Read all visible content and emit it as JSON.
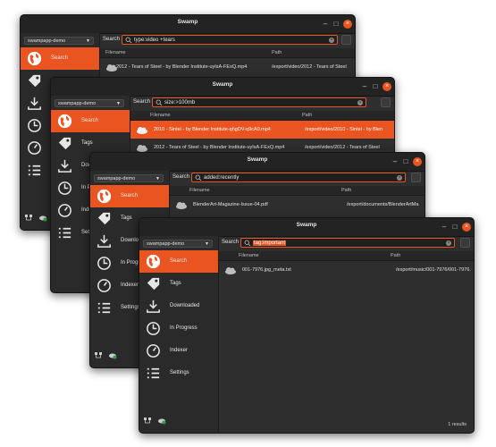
{
  "app": {
    "title": "Swamp"
  },
  "project": "swampapp-demo",
  "search": {
    "label": "Search"
  },
  "nav": [
    {
      "label": "Search",
      "icon": "globe-icon"
    },
    {
      "label": "Tags",
      "icon": "tag-icon"
    },
    {
      "label": "Downloaded",
      "icon": "download-icon"
    },
    {
      "label": "In Progress",
      "icon": "clock-icon"
    },
    {
      "label": "Indexer",
      "icon": "gauge-icon"
    },
    {
      "label": "Settings",
      "icon": "list-icon"
    }
  ],
  "columns": {
    "filename": "Filename",
    "path": "Path"
  },
  "windows": [
    {
      "query": "type:video +tears",
      "rows": [
        {
          "filename": "2012 - Tears of Steel - by Blender Institute-uyIsA-FExQ.mp4",
          "path": "/export/video/2012 - Tears of Steel"
        }
      ]
    },
    {
      "query": "size:>100mb",
      "rows": [
        {
          "filename": "2010 - Sintel - by Blender Institute-qhgDV-q9cA0.mp4",
          "path": "/export/video/2010 - Sintel - by Blen"
        },
        {
          "filename": "2012 - Tears of Steel - by Blender Institute-uyIsA-FExQ.mp4",
          "path": "/export/video/2012 - Tears of Steel"
        }
      ]
    },
    {
      "query": "added:recently",
      "rows": [
        {
          "filename": "BlenderArt-Magazine-Issue-04.pdf",
          "path": "/export/documents/BlenderArtMa"
        }
      ]
    },
    {
      "query": "tag:important",
      "rows": [
        {
          "filename": "001-7976.jpg_meta.txt",
          "path": "/export/music/001-7976/001-7976."
        }
      ],
      "status": "1 results"
    }
  ],
  "colors": {
    "accent": "#e95420",
    "background": "#2e2e2e",
    "sidebar": "#2a2a2a"
  }
}
